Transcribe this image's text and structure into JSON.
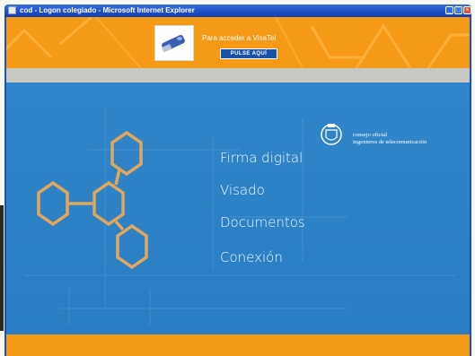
{
  "window": {
    "title": "cod - Logon colegiado - Microsoft Internet Explorer",
    "minimize_glyph": "_",
    "maximize_glyph": "□",
    "close_glyph": "×"
  },
  "banner": {
    "access_text": "Para acceder a VisaTel",
    "button_label": "PULSE AQUÍ",
    "usb_icon": "usb-token-icon"
  },
  "logo": {
    "line1": "consejo oficial",
    "line2": "ingenieros de telecomunicación",
    "icon": "coat-of-arms-icon"
  },
  "menu": {
    "items": [
      {
        "label": "Firma digital"
      },
      {
        "label": "Visado"
      },
      {
        "label": "Documentos"
      },
      {
        "label": "Conexión"
      }
    ]
  },
  "colors": {
    "banner_orange": "#f59a16",
    "content_blue": "#2f83c7",
    "hexagon_stroke": "#e2a65a",
    "titlebar_blue": "#1c4fc6"
  }
}
